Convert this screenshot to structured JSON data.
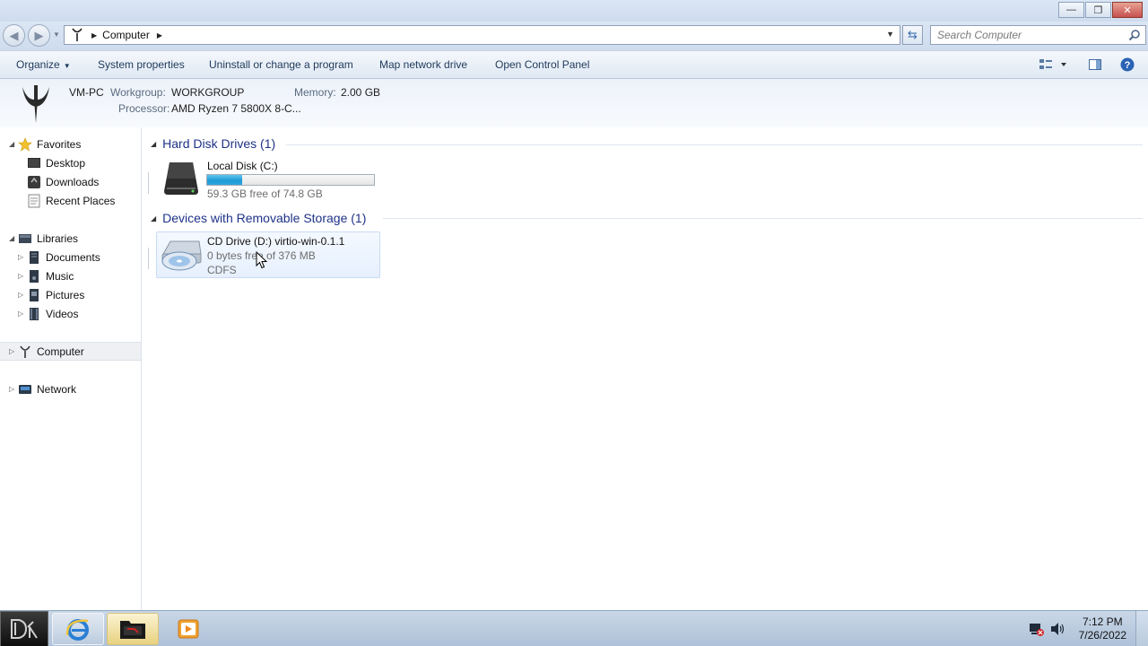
{
  "window": {
    "minimize": "—",
    "maximize": "❐",
    "close": "✕"
  },
  "address": {
    "crumbs": [
      "Computer"
    ],
    "search_placeholder": "Search Computer"
  },
  "toolbar": {
    "organize": "Organize",
    "system_properties": "System properties",
    "uninstall": "Uninstall or change a program",
    "map_drive": "Map network drive",
    "control_panel": "Open Control Panel"
  },
  "details": {
    "computer_name": "VM-PC",
    "workgroup_label": "Workgroup:",
    "workgroup": "WORKGROUP",
    "memory_label": "Memory:",
    "memory": "2.00 GB",
    "processor_label": "Processor:",
    "processor": "AMD Ryzen 7 5800X 8-C..."
  },
  "nav": {
    "favorites": "Favorites",
    "desktop": "Desktop",
    "downloads": "Downloads",
    "recent": "Recent Places",
    "libraries": "Libraries",
    "documents": "Documents",
    "music": "Music",
    "pictures": "Pictures",
    "videos": "Videos",
    "computer": "Computer",
    "network": "Network"
  },
  "content": {
    "hdd_group": "Hard Disk Drives (1)",
    "removable_group": "Devices with Removable Storage (1)",
    "local_disk": {
      "name": "Local Disk (C:)",
      "free_text": "59.3 GB free of 74.8 GB",
      "used_fraction": 0.207
    },
    "cd_drive": {
      "name": "CD Drive (D:) virtio-win-0.1.1",
      "free_text": "0 bytes free of 376 MB",
      "fs": "CDFS"
    }
  },
  "taskbar": {
    "time": "7:12 PM",
    "date": "7/26/2022"
  },
  "colors": {
    "group_header": "#1e3287",
    "bar_fill": "#1f9ad6",
    "toolbar_text": "#1e395b"
  }
}
